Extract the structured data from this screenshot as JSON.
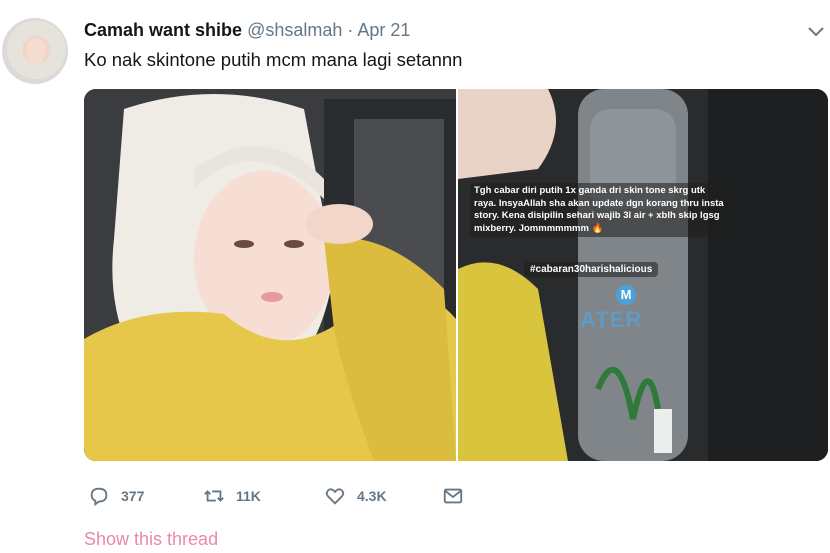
{
  "tweet": {
    "display_name": "Camah want shibe",
    "handle": "@shsalmah",
    "separator": "·",
    "date": "Apr 21",
    "text": "Ko nak skintone putih mcm mana lagi setannn"
  },
  "media": {
    "story_text": "Tgh cabar diri putih 1x ganda dri skin tone skrg utk raya. InsyaAllah sha akan update dgn korang thru insta story. Kena disipilin sehari wajib 3l air + xblh skip lgsg mixberry. Jommmmmmm 🔥",
    "story_hashtag": "#cabaran30harishalicious",
    "bottle_mark": "M",
    "bottle_label": "ATER"
  },
  "actions": {
    "reply_count": "377",
    "retweet_count": "11K",
    "like_count": "4.3K"
  },
  "show_thread": "Show this thread",
  "icons": [
    "chevron-down-icon",
    "reply-icon",
    "retweet-icon",
    "like-icon",
    "message-icon"
  ],
  "colors": {
    "text": "#14171a",
    "secondary": "#657786",
    "link": "#e0245e"
  }
}
